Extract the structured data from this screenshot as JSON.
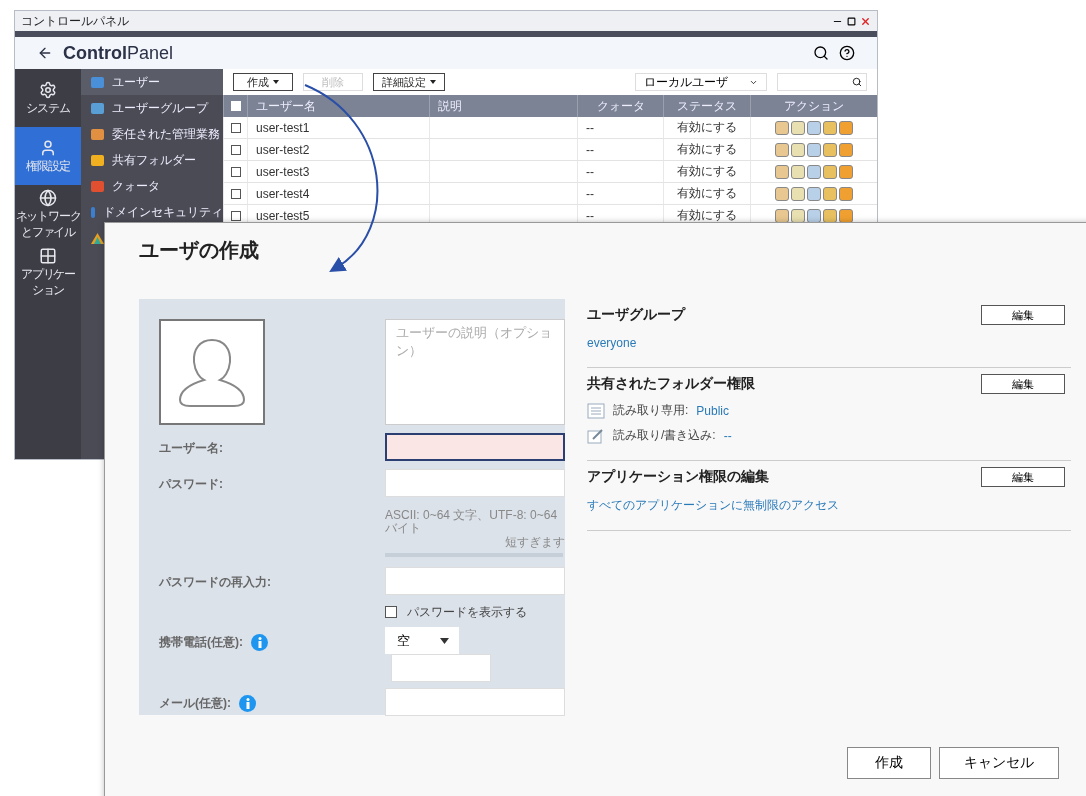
{
  "window": {
    "title": "コントロールパネル",
    "app_title_bold": "Control",
    "app_title_rest": "Panel"
  },
  "nav": [
    {
      "lines": [
        "システム"
      ],
      "selected": false
    },
    {
      "lines": [
        "権限設定"
      ],
      "selected": true
    },
    {
      "lines": [
        "ネットワーク",
        "とファイル"
      ],
      "selected": false
    },
    {
      "lines": [
        "アプリケー",
        "ション"
      ],
      "selected": false
    }
  ],
  "sidebar": {
    "items": [
      {
        "label": "ユーザー",
        "selected": true
      },
      {
        "label": "ユーザーグループ",
        "selected": false
      },
      {
        "label": "委任された管理業務",
        "selected": false
      },
      {
        "label": "共有フォルダー",
        "selected": false
      },
      {
        "label": "クォータ",
        "selected": false
      },
      {
        "label": "ドメインセキュリティ",
        "selected": false
      }
    ]
  },
  "toolbar": {
    "buttons": [
      {
        "label": "作成",
        "disabled": false,
        "caret": true
      },
      {
        "label": "削除",
        "disabled": true,
        "caret": false
      },
      {
        "label": "詳細設定",
        "disabled": false,
        "caret": true
      }
    ],
    "filter": "ローカルユーザ"
  },
  "table": {
    "all_checked": false,
    "columns": [
      "ユーザー名",
      "説明",
      "クォータ",
      "ステータス",
      "アクション"
    ],
    "rows": [
      {
        "name": "user-test1",
        "quota": "--",
        "status": "有効にする",
        "checked": false
      },
      {
        "name": "user-test2",
        "quota": "--",
        "status": "有効にする",
        "checked": false
      },
      {
        "name": "user-test3",
        "quota": "--",
        "status": "有効にする",
        "checked": false
      },
      {
        "name": "user-test4",
        "quota": "--",
        "status": "有効にする",
        "checked": false
      },
      {
        "name": "user-test5",
        "quota": "--",
        "status": "有効にする",
        "checked": false
      }
    ]
  },
  "dialog": {
    "title": "ユーザの作成",
    "description_placeholder": "ユーザーの説明（オプション）",
    "username": {
      "label": "ユーザー名:",
      "focused": true
    },
    "password": {
      "label": "パスワード:",
      "hint": "ASCII: 0~64 文字、UTF-8: 0~64 バイト",
      "strength": "短すぎます",
      "level": 0
    },
    "password_confirm": {
      "label": "パスワードの再入力:"
    },
    "show_password": {
      "label": "パスワードを表示する",
      "checked": false
    },
    "phone": {
      "label": "携帯電話(任意):",
      "country": "空"
    },
    "email": {
      "label": "メール(任意):"
    },
    "sections": [
      {
        "title": "ユーザグループ",
        "button": "編集",
        "kind": "link",
        "link": "everyone"
      },
      {
        "title": "共有されたフォルダー権限",
        "button": "編集",
        "kind": "permissions",
        "rows": [
          {
            "kind": "read",
            "label": "読み取り専用:",
            "value": "Public"
          },
          {
            "kind": "write",
            "label": "読み取り/書き込み:",
            "value": "--"
          }
        ]
      },
      {
        "title": "アプリケーション権限の編集",
        "button": "編集",
        "kind": "link",
        "link": "すべてのアプリケーションに無制限のアクセス"
      }
    ],
    "buttons": [
      "作成",
      "キャンセル"
    ]
  }
}
